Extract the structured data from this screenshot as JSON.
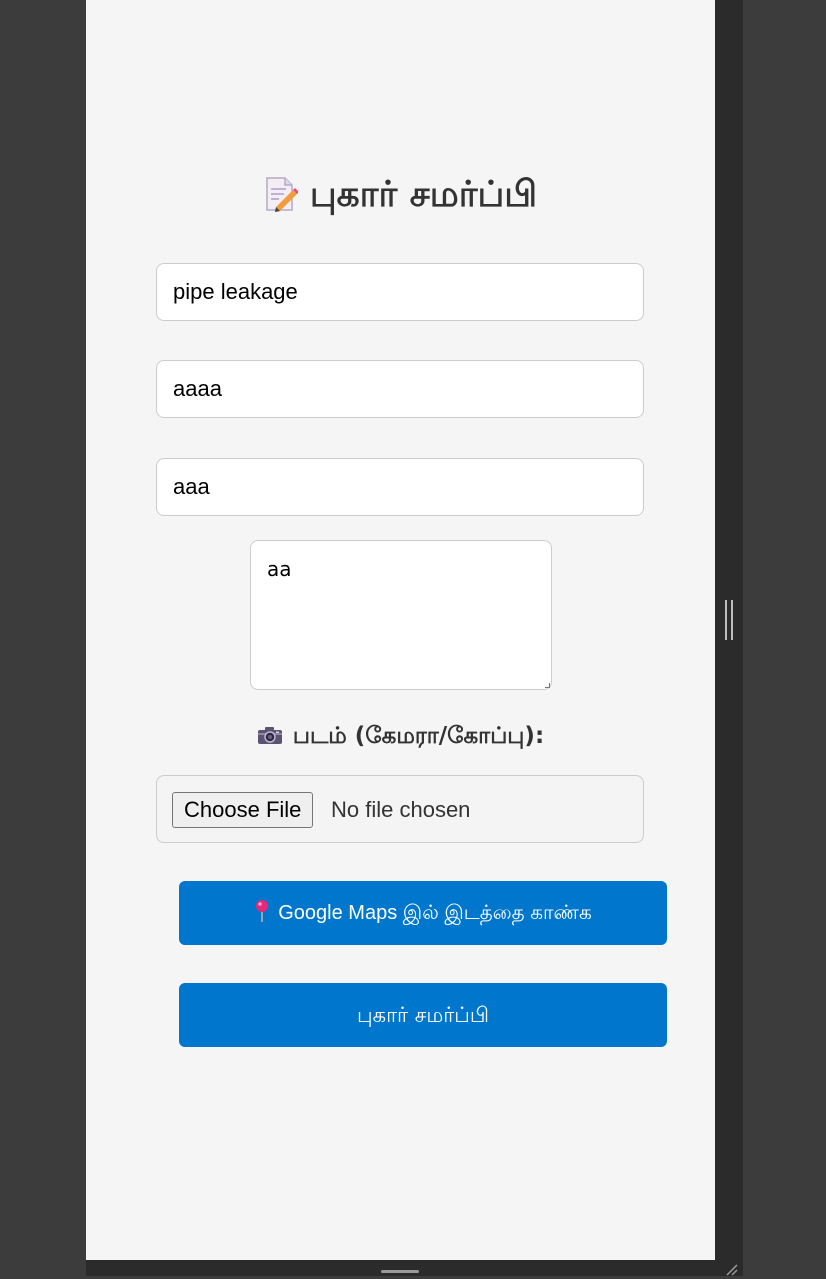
{
  "form": {
    "title": "புகார் சமர்ப்பி",
    "title_icon": "memo-icon",
    "fields": [
      {
        "value": "pipe leakage"
      },
      {
        "value": "aaaa"
      },
      {
        "value": "aaa"
      }
    ],
    "description": {
      "value": "aa"
    },
    "photo_label": "படம் (கேமரா/கோப்பு):",
    "photo_icon": "camera-icon",
    "file_input": {
      "button_label": "Choose File",
      "status": "No file chosen"
    },
    "maps_button": {
      "icon": "round-pushpin-icon",
      "label": "Google Maps இல் இடத்தை காண்க"
    },
    "submit_button": {
      "label": "புகார் சமர்ப்பி"
    }
  },
  "colors": {
    "accent": "#0077cc",
    "panel_bg": "#f5f5f5",
    "window_bg": "#3c3c3c"
  }
}
